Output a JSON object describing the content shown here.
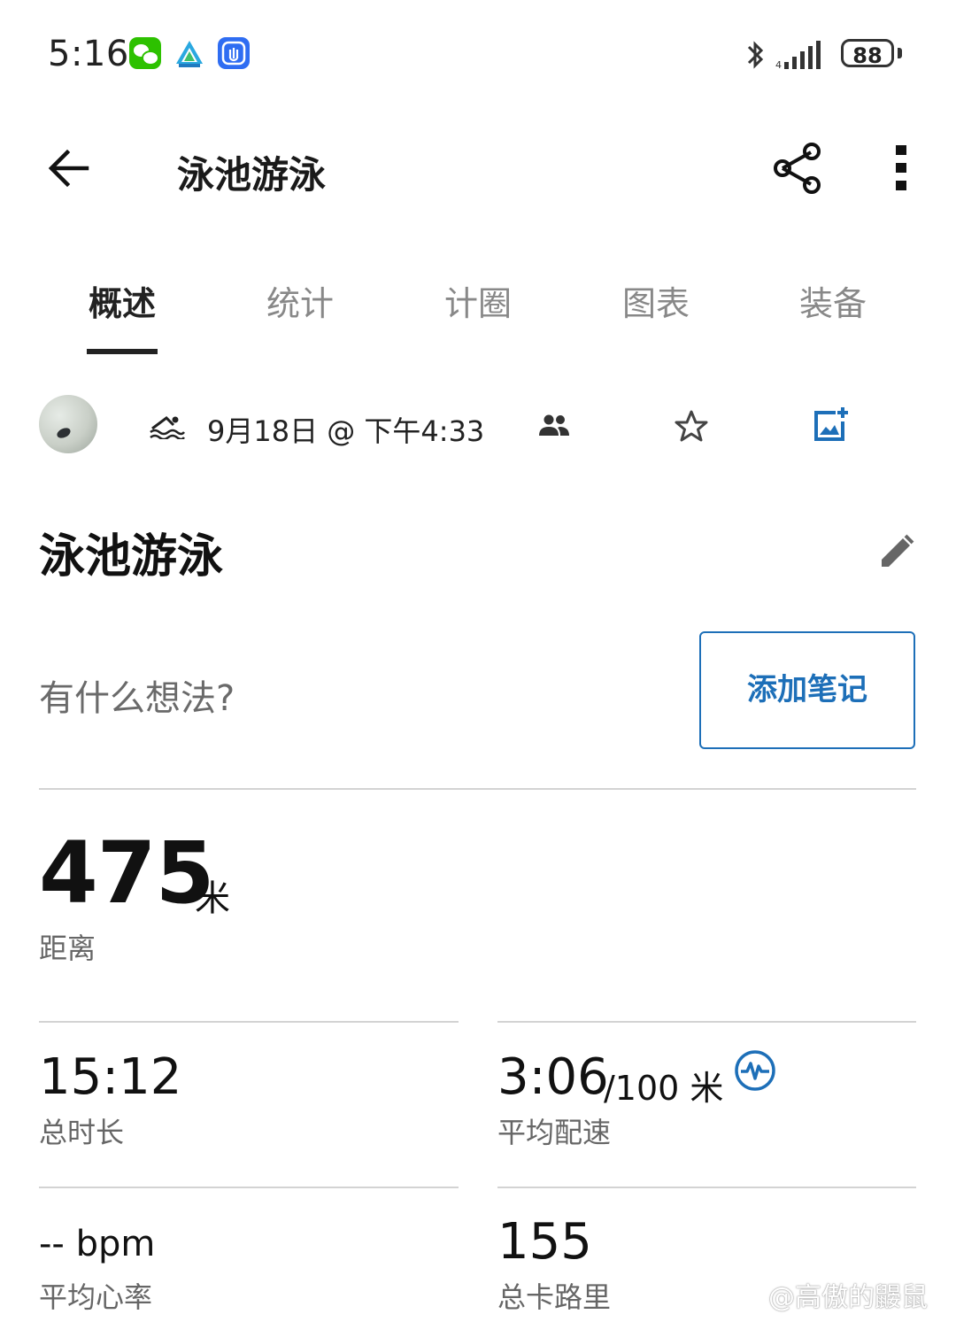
{
  "status_bar": {
    "time": "5:16",
    "battery": "88",
    "icons": [
      "wechat-icon",
      "app-icon",
      "app-icon",
      "bluetooth-icon",
      "signal-icon",
      "battery-icon"
    ]
  },
  "header": {
    "title": "泳池游泳",
    "icons": [
      "back-arrow-icon",
      "share-icon",
      "more-vert-icon"
    ]
  },
  "tabs": [
    {
      "label": "概述",
      "active": true
    },
    {
      "label": "统计",
      "active": false
    },
    {
      "label": "计圈",
      "active": false
    },
    {
      "label": "图表",
      "active": false
    },
    {
      "label": "装备",
      "active": false
    }
  ],
  "meta": {
    "datetime": "9月18日 @ 下午4:33",
    "icons": [
      "swim-icon",
      "people-icon",
      "star-icon",
      "add-photo-icon"
    ]
  },
  "activity": {
    "title": "泳池游泳",
    "prompt": "有什么想法?",
    "add_note_label": "添加笔记"
  },
  "distance": {
    "value": "475",
    "unit": "米",
    "label": "距离"
  },
  "stats": {
    "total_time": {
      "value": "15:12",
      "label": "总时长"
    },
    "avg_pace": {
      "value": "3:06",
      "suffix": "/100 米",
      "label": "平均配速"
    },
    "avg_hr": {
      "value": "-- bpm",
      "label": "平均心率"
    },
    "calories": {
      "value": "155",
      "label": "总卡路里"
    }
  },
  "watermark": "@高傲的鼹鼠",
  "colors": {
    "accent": "#1d6fb8",
    "text_primary": "#111111",
    "text_secondary": "#666666",
    "divider": "#d3d3d3"
  }
}
